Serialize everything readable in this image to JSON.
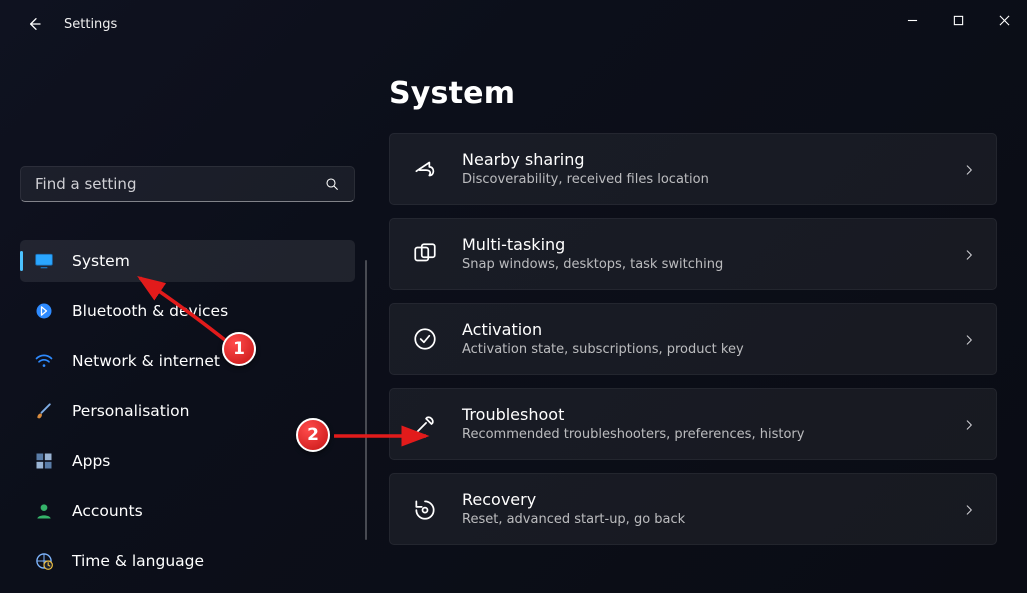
{
  "app": {
    "title": "Settings"
  },
  "search": {
    "placeholder": "Find a setting"
  },
  "sidebar": {
    "items": [
      {
        "label": "System"
      },
      {
        "label": "Bluetooth & devices"
      },
      {
        "label": "Network & internet"
      },
      {
        "label": "Personalisation"
      },
      {
        "label": "Apps"
      },
      {
        "label": "Accounts"
      },
      {
        "label": "Time & language"
      }
    ]
  },
  "page": {
    "title": "System"
  },
  "cards": [
    {
      "title": "Nearby sharing",
      "sub": "Discoverability, received files location"
    },
    {
      "title": "Multi-tasking",
      "sub": "Snap windows, desktops, task switching"
    },
    {
      "title": "Activation",
      "sub": "Activation state, subscriptions, product key"
    },
    {
      "title": "Troubleshoot",
      "sub": "Recommended troubleshooters, preferences, history"
    },
    {
      "title": "Recovery",
      "sub": "Reset, advanced start-up, go back"
    }
  ],
  "annotations": {
    "badge1": "1",
    "badge2": "2"
  }
}
